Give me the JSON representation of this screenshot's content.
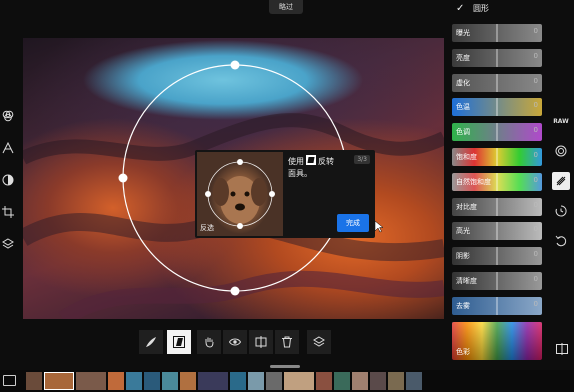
{
  "top_button": "略过",
  "panel": {
    "title": "圆形",
    "sliders": [
      {
        "label": "曝光",
        "value": "0"
      },
      {
        "label": "亮度",
        "value": "0"
      },
      {
        "label": "虚化",
        "value": "0"
      },
      {
        "label": "色温",
        "value": "0"
      },
      {
        "label": "色调",
        "value": "0"
      },
      {
        "label": "饱和度",
        "value": "0"
      },
      {
        "label": "自然饱和度",
        "value": "0"
      },
      {
        "label": "对比度",
        "value": "0"
      },
      {
        "label": "高光",
        "value": "0"
      },
      {
        "label": "阴影",
        "value": "0"
      },
      {
        "label": "清晰度",
        "value": "0"
      },
      {
        "label": "去雾",
        "value": "0"
      }
    ],
    "color_label": "色彩"
  },
  "popup": {
    "text_part1": "使用",
    "text_part2": "反转",
    "text_part3": "面具。",
    "page": "3/3",
    "done": "完成",
    "invert_label": "反选"
  },
  "right_tools": {
    "raw": "RAW"
  },
  "colors": {
    "accent": "#1a73e8"
  }
}
